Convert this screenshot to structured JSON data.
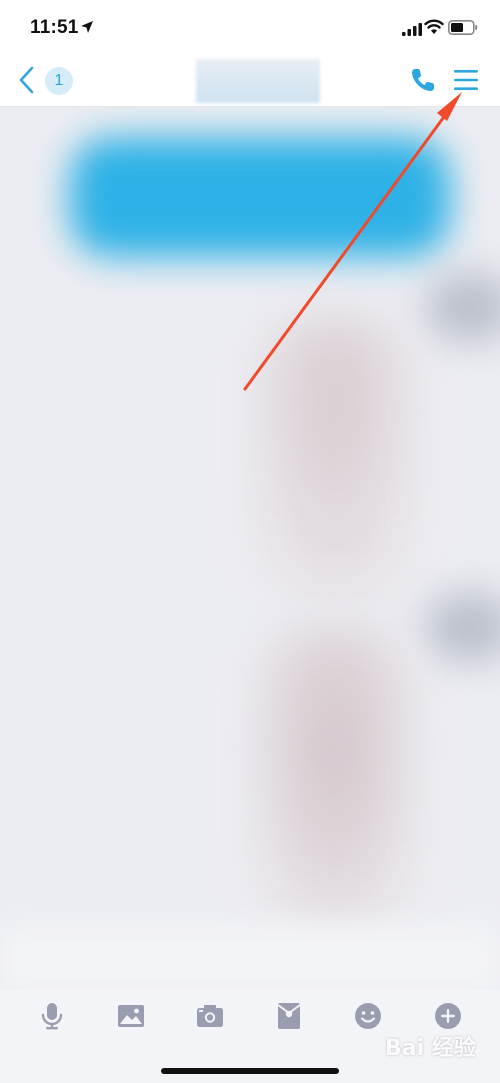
{
  "status_bar": {
    "time": "11:51",
    "icons": [
      "location-arrow-icon",
      "cellular-signal-icon",
      "wifi-icon",
      "battery-icon"
    ]
  },
  "nav": {
    "back_icon": "chevron-left-icon",
    "unread_count": "1",
    "title": "",
    "call_icon": "phone-icon",
    "menu_icon": "hamburger-menu-icon",
    "accent_color": "#2EA7E0"
  },
  "annotation": {
    "arrow_color": "#F0492B",
    "points_to": "hamburger-menu-icon"
  },
  "toolbar": {
    "items": [
      {
        "icon": "microphone-icon"
      },
      {
        "icon": "image-icon"
      },
      {
        "icon": "camera-icon"
      },
      {
        "icon": "red-packet-icon"
      },
      {
        "icon": "emoji-icon"
      },
      {
        "icon": "plus-icon"
      }
    ],
    "icon_color": "#9A9DB0"
  },
  "watermark": {
    "text": "Bai 经验"
  }
}
